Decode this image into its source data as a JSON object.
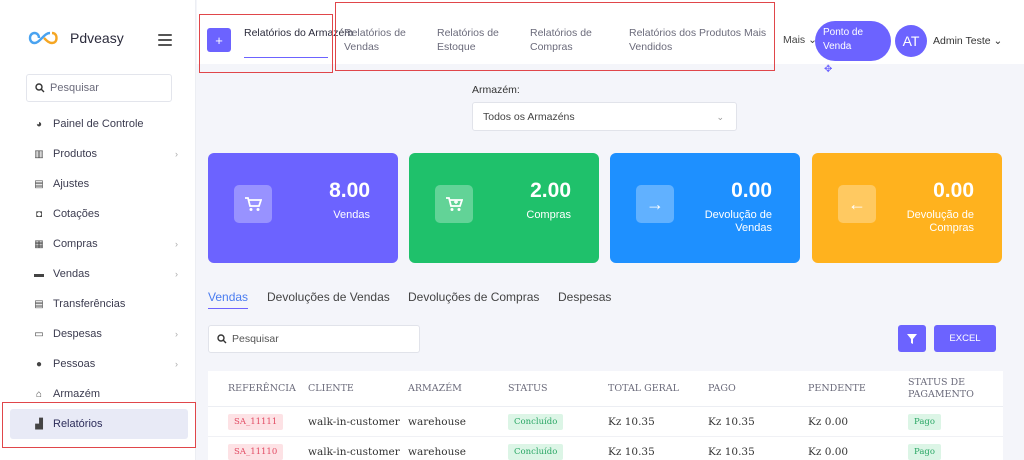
{
  "app": {
    "name": "Pdveasy"
  },
  "sidebar": {
    "search_placeholder": "Pesquisar",
    "items": [
      {
        "label": "Painel de Controle",
        "icon": "pie-chart-icon",
        "chevron": false
      },
      {
        "label": "Produtos",
        "icon": "barcode-icon",
        "chevron": true
      },
      {
        "label": "Ajustes",
        "icon": "adjust-icon",
        "chevron": false
      },
      {
        "label": "Cotações",
        "icon": "bag-icon",
        "chevron": false
      },
      {
        "label": "Compras",
        "icon": "receipt-icon",
        "chevron": true
      },
      {
        "label": "Vendas",
        "icon": "cart-icon",
        "chevron": true
      },
      {
        "label": "Transferências",
        "icon": "transfer-icon",
        "chevron": false
      },
      {
        "label": "Despesas",
        "icon": "money-icon",
        "chevron": true
      },
      {
        "label": "Pessoas",
        "icon": "person-icon",
        "chevron": true
      },
      {
        "label": "Armazém",
        "icon": "home-icon",
        "chevron": false
      },
      {
        "label": "Relatórios",
        "icon": "chart-icon",
        "chevron": false,
        "active": true
      }
    ]
  },
  "header": {
    "tabs": [
      {
        "label": "Relatórios do Armazém",
        "active": true
      },
      {
        "label": "Relatórios de Vendas"
      },
      {
        "label": "Relatórios de Estoque"
      },
      {
        "label": "Relatórios de Compras"
      },
      {
        "label": "Relatórios dos Produtos Mais Vendidos"
      }
    ],
    "more_label": "Mais",
    "pos_button": "Ponto de Venda",
    "avatar_initials": "AT",
    "user_name": "Admin Teste"
  },
  "filter": {
    "warehouse_label": "Armazém:",
    "warehouse_value": "Todos os Armazéns"
  },
  "cards": [
    {
      "value": "8.00",
      "label": "Vendas",
      "color": "#6c63ff",
      "icon": "cart-icon"
    },
    {
      "value": "2.00",
      "label": "Compras",
      "color": "#1fc16b",
      "icon": "cart-plus-icon"
    },
    {
      "value": "0.00",
      "label": "Devolução de Vendas",
      "color": "#1e90ff",
      "icon": "arrow-right-icon"
    },
    {
      "value": "0.00",
      "label": "Devolução de Compras",
      "color": "#ffb21e",
      "icon": "arrow-left-icon"
    }
  ],
  "section_tabs": [
    "Vendas",
    "Devoluções de Vendas",
    "Devoluções de Compras",
    "Despesas"
  ],
  "table": {
    "search_placeholder": "Pesquisar",
    "excel_label": "EXCEL",
    "headers": [
      "REFERÊNCIA",
      "CLIENTE",
      "ARMAZÉM",
      "STATUS",
      "TOTAL GERAL",
      "PAGO",
      "PENDENTE",
      "STATUS DE PAGAMENTO"
    ],
    "rows": [
      {
        "ref": "SA_11111",
        "client": "walk-in-customer",
        "warehouse": "warehouse",
        "status": "Concluído",
        "total": "Kz 10.35",
        "paid": "Kz 10.35",
        "due": "Kz 0.00",
        "payment_status": "Pago"
      },
      {
        "ref": "SA_11110",
        "client": "walk-in-customer",
        "warehouse": "warehouse",
        "status": "Concluído",
        "total": "Kz 10.35",
        "paid": "Kz 10.35",
        "due": "Kz 0.00",
        "payment_status": "Pago"
      }
    ]
  }
}
